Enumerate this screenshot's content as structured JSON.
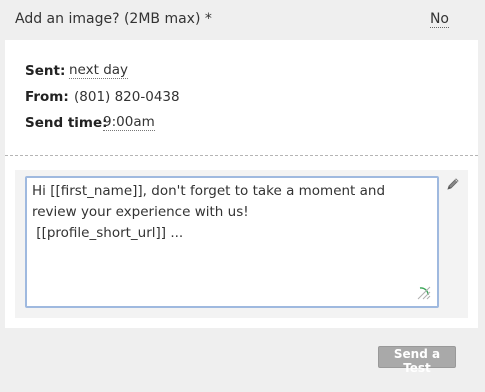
{
  "image_upload": {
    "label": "Add an image? (2MB max) *",
    "toggle": "No"
  },
  "schedule": {
    "sent_label": "Sent:",
    "sent_value": "next day",
    "from_label": "From:",
    "from_value": "(801) 820-0438",
    "time_label": "Send time:",
    "time_value": "9:00am"
  },
  "message": {
    "body": "Hi [[first_name]], don't forget to take a moment and review your experience with us!\n [[profile_short_url]] ..."
  },
  "actions": {
    "send_test": "Send a Test"
  },
  "colors": {
    "page_bg": "#efefef",
    "textarea_border": "#9fb9df",
    "button_bg": "#a9a9a9",
    "resize_indicator": "#3aa657"
  },
  "icons": {
    "edit": "pencil-icon",
    "resize": "resize-handle-icon"
  }
}
